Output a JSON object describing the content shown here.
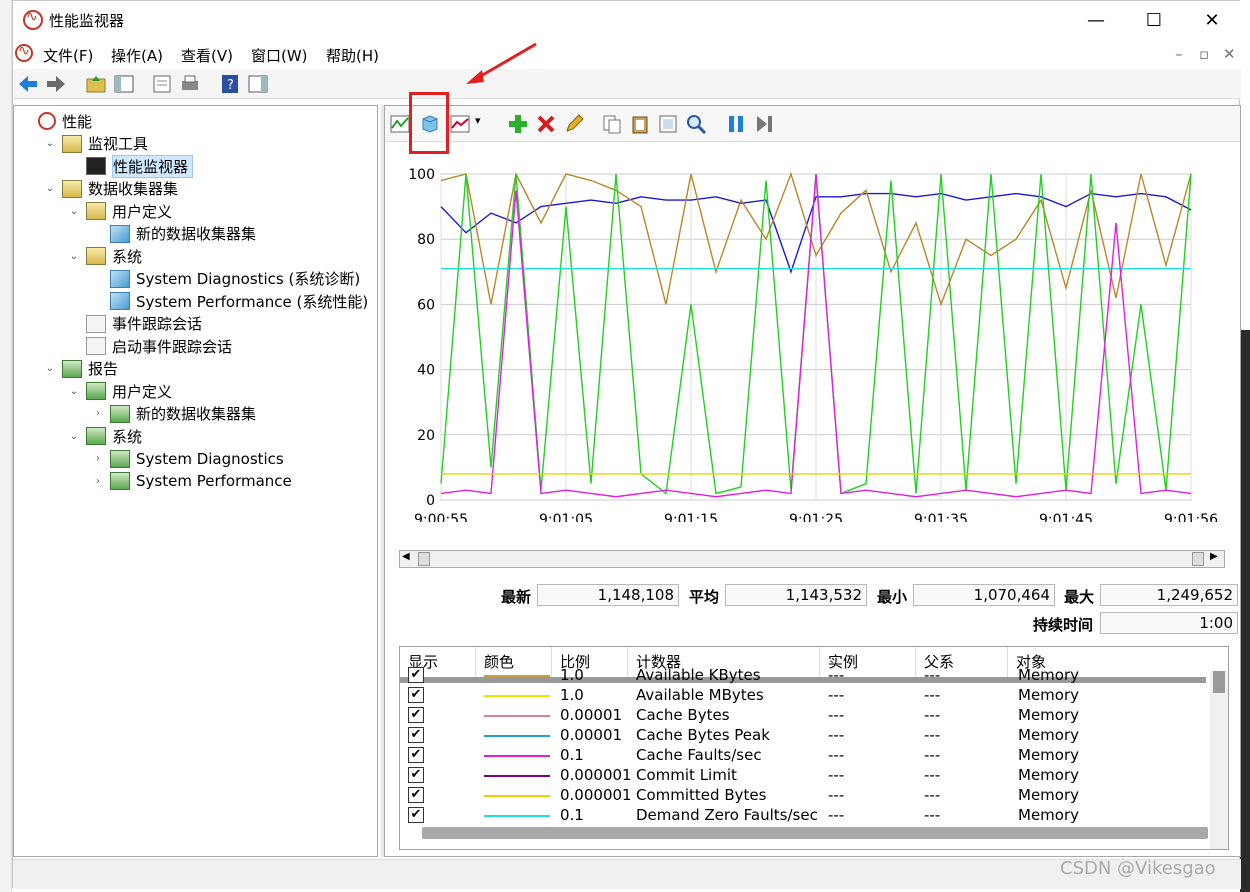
{
  "window": {
    "title": "性能监视器",
    "menu": [
      "文件(F)",
      "操作(A)",
      "查看(V)",
      "窗口(W)",
      "帮助(H)"
    ]
  },
  "tree": [
    {
      "label": "性能",
      "depth": 0,
      "toggle": "",
      "icon": "perf"
    },
    {
      "label": "监视工具",
      "depth": 1,
      "toggle": "⌄",
      "icon": "folder"
    },
    {
      "label": "性能监视器",
      "depth": 2,
      "toggle": "",
      "icon": "mon",
      "selected": true
    },
    {
      "label": "数据收集器集",
      "depth": 1,
      "toggle": "⌄",
      "icon": "folder"
    },
    {
      "label": "用户定义",
      "depth": 2,
      "toggle": "⌄",
      "icon": "folder"
    },
    {
      "label": "新的数据收集器集",
      "depth": 3,
      "toggle": "",
      "icon": "cube"
    },
    {
      "label": "系统",
      "depth": 2,
      "toggle": "⌄",
      "icon": "folder"
    },
    {
      "label": "System Diagnostics (系统诊断)",
      "depth": 3,
      "toggle": "",
      "icon": "cube"
    },
    {
      "label": "System Performance (系统性能)",
      "depth": 3,
      "toggle": "",
      "icon": "cube"
    },
    {
      "label": "事件跟踪会话",
      "depth": 2,
      "toggle": "",
      "icon": "doc"
    },
    {
      "label": "启动事件跟踪会话",
      "depth": 2,
      "toggle": "",
      "icon": "doc"
    },
    {
      "label": "报告",
      "depth": 1,
      "toggle": "⌄",
      "icon": "report"
    },
    {
      "label": "用户定义",
      "depth": 2,
      "toggle": "⌄",
      "icon": "report"
    },
    {
      "label": "新的数据收集器集",
      "depth": 3,
      "toggle": "›",
      "icon": "report"
    },
    {
      "label": "系统",
      "depth": 2,
      "toggle": "⌄",
      "icon": "report"
    },
    {
      "label": "System Diagnostics",
      "depth": 3,
      "toggle": "›",
      "icon": "report"
    },
    {
      "label": "System Performance",
      "depth": 3,
      "toggle": "›",
      "icon": "report"
    }
  ],
  "stats": {
    "latest_label": "最新",
    "latest": "1,148,108",
    "avg_label": "平均",
    "avg": "1,143,532",
    "min_label": "最小",
    "min": "1,070,464",
    "max_label": "最大",
    "max": "1,249,652",
    "duration_label": "持续时间",
    "duration": "1:00"
  },
  "legend": {
    "headers": [
      "显示",
      "颜色",
      "比例",
      "计数器",
      "实例",
      "父系",
      "对象"
    ],
    "rows": [
      {
        "scale": "1.0",
        "counter": "Available KBytes",
        "instance": "---",
        "parent": "---",
        "object": "Memory",
        "color": "#c8a040"
      },
      {
        "scale": "1.0",
        "counter": "Available MBytes",
        "instance": "---",
        "parent": "---",
        "object": "Memory",
        "color": "#f0e000"
      },
      {
        "scale": "0.00001",
        "counter": "Cache Bytes",
        "instance": "---",
        "parent": "---",
        "object": "Memory",
        "color": "#e08090"
      },
      {
        "scale": "0.00001",
        "counter": "Cache Bytes Peak",
        "instance": "---",
        "parent": "---",
        "object": "Memory",
        "color": "#20a0e0"
      },
      {
        "scale": "0.1",
        "counter": "Cache Faults/sec",
        "instance": "---",
        "parent": "---",
        "object": "Memory",
        "color": "#e020e0"
      },
      {
        "scale": "0.000001",
        "counter": "Commit Limit",
        "instance": "---",
        "parent": "---",
        "object": "Memory",
        "color": "#800080"
      },
      {
        "scale": "0.000001",
        "counter": "Committed Bytes",
        "instance": "---",
        "parent": "---",
        "object": "Memory",
        "color": "#f0d000"
      },
      {
        "scale": "0.1",
        "counter": "Demand Zero Faults/sec",
        "instance": "---",
        "parent": "---",
        "object": "Memory",
        "color": "#20e0e0"
      }
    ]
  },
  "chart_data": {
    "type": "line",
    "x": [
      "9:00:55",
      "9:01:05",
      "9:01:15",
      "9:01:25",
      "9:01:35",
      "9:01:45",
      "9:01:56"
    ],
    "yticks": [
      0,
      20,
      40,
      60,
      80,
      100
    ],
    "ylim": [
      0,
      100
    ],
    "grid": true,
    "series": [
      {
        "color": "#1a1ad0",
        "values": [
          90,
          82,
          88,
          85,
          90,
          91,
          92,
          91,
          93,
          92,
          92,
          93,
          91,
          92,
          70,
          93,
          93,
          94,
          94,
          93,
          94,
          92,
          93,
          94,
          93,
          90,
          94,
          93,
          94,
          93,
          89
        ]
      },
      {
        "color": "#b8882a",
        "values": [
          98,
          100,
          60,
          100,
          85,
          100,
          98,
          95,
          90,
          60,
          100,
          70,
          92,
          80,
          100,
          75,
          88,
          95,
          70,
          85,
          60,
          80,
          75,
          80,
          92,
          65,
          95,
          62,
          100,
          72,
          100
        ]
      },
      {
        "color": "#22d022",
        "values": [
          5,
          100,
          10,
          100,
          3,
          90,
          5,
          100,
          8,
          2,
          60,
          2,
          4,
          98,
          3,
          100,
          2,
          5,
          98,
          2,
          100,
          3,
          100,
          5,
          100,
          3,
          100,
          5,
          60,
          3,
          100
        ]
      },
      {
        "color": "#20e0e0",
        "values": [
          71,
          71,
          71,
          71,
          71,
          71,
          71,
          71,
          71,
          71,
          71,
          71,
          71,
          71,
          71,
          71,
          71,
          71,
          71,
          71,
          71,
          71,
          71,
          71,
          71,
          71,
          71,
          71,
          71,
          71,
          71
        ]
      },
      {
        "color": "#e020e0",
        "values": [
          2,
          3,
          2,
          95,
          2,
          3,
          2,
          1,
          2,
          3,
          2,
          1,
          2,
          3,
          2,
          100,
          2,
          3,
          2,
          1,
          2,
          3,
          2,
          1,
          2,
          3,
          2,
          85,
          2,
          3,
          2
        ]
      },
      {
        "color": "#f0d000",
        "values": [
          8,
          8,
          8,
          8,
          8,
          8,
          8,
          8,
          8,
          8,
          8,
          8,
          8,
          8,
          8,
          8,
          8,
          8,
          8,
          8,
          8,
          8,
          8,
          8,
          8,
          8,
          8,
          8,
          8,
          8,
          8
        ]
      }
    ]
  },
  "footer": {
    "watermark": "CSDN @Vikesgao"
  }
}
